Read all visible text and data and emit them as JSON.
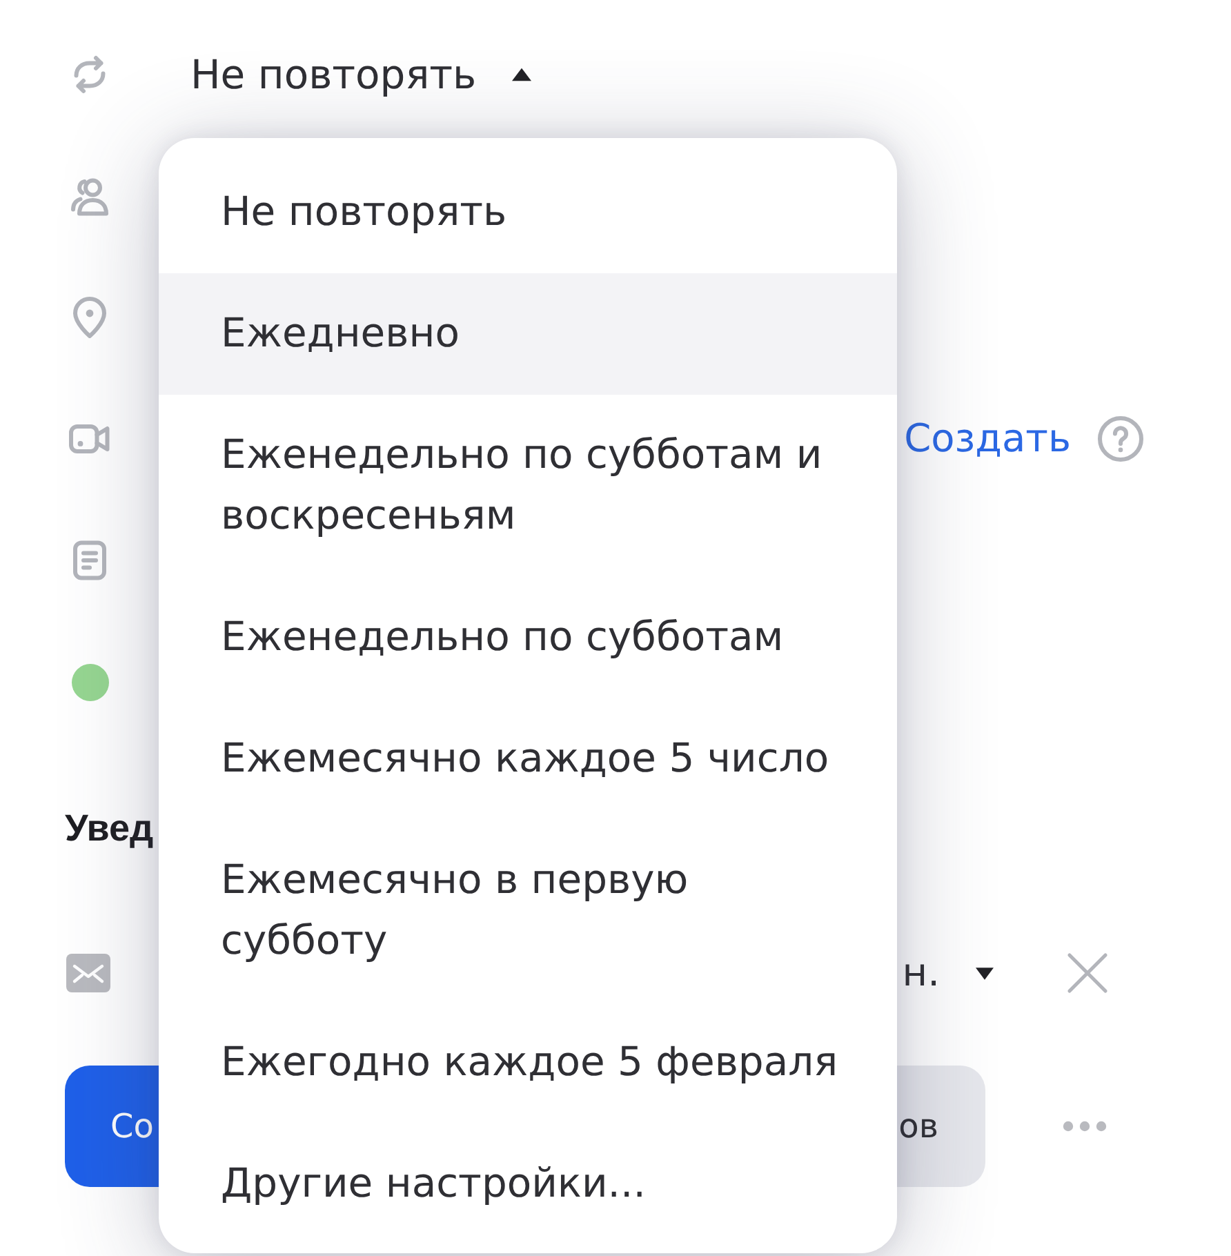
{
  "repeat_field": {
    "value": "Не повторять",
    "expanded": true
  },
  "repeat_menu": {
    "items": [
      {
        "label": "Не повторять",
        "selected": false
      },
      {
        "label": "Ежедневно",
        "selected": true
      },
      {
        "label": "Еженедельно по субботам и воскресеньям",
        "selected": false
      },
      {
        "label": "Еженедельно по субботам",
        "selected": false
      },
      {
        "label": "Ежемесячно каждое 5 число",
        "selected": false
      },
      {
        "label": "Ежемесячно в первую субботу",
        "selected": false
      },
      {
        "label": "Ежегодно каждое 5 февраля",
        "selected": false
      },
      {
        "label": "Другие настройки...",
        "selected": false
      }
    ]
  },
  "conference": {
    "link": "Создать"
  },
  "event_color": {
    "color": "#96d691"
  },
  "notifications": {
    "heading": "Увед",
    "reminder": {
      "value": "н."
    }
  },
  "actions": [
    {
      "kind": "primary",
      "label": "Со"
    },
    {
      "kind": "secondary",
      "label": "ов"
    }
  ]
}
